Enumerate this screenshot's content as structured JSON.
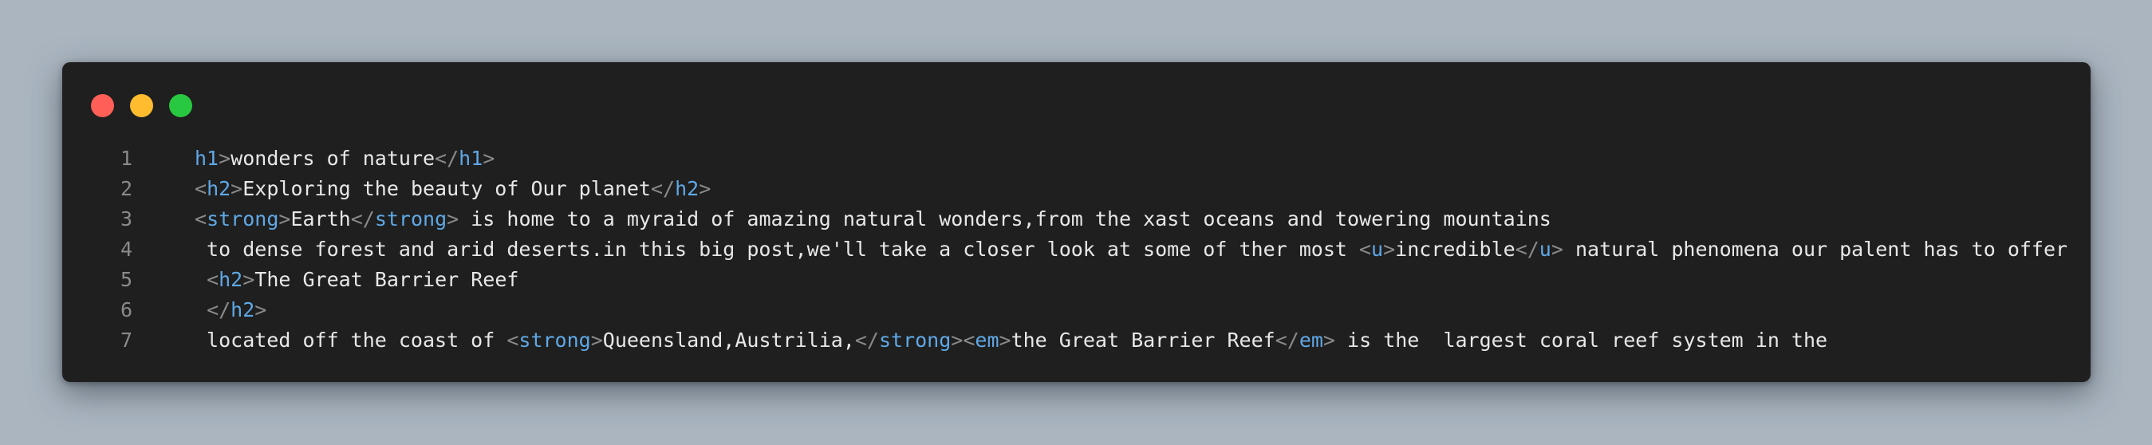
{
  "window": {
    "controls": {
      "close_color": "#ff5f57",
      "minimize_color": "#febc2e",
      "maximize_color": "#28c840"
    }
  },
  "editor": {
    "lines": [
      {
        "number": "1",
        "tokens": [
          {
            "kind": "tag",
            "text": "h1"
          },
          {
            "kind": "bracket",
            "text": ">"
          },
          {
            "kind": "text",
            "text": "wonders of nature"
          },
          {
            "kind": "bracket",
            "text": "</"
          },
          {
            "kind": "tag",
            "text": "h1"
          },
          {
            "kind": "bracket",
            "text": ">"
          }
        ]
      },
      {
        "number": "2",
        "tokens": [
          {
            "kind": "bracket",
            "text": "<"
          },
          {
            "kind": "tag",
            "text": "h2"
          },
          {
            "kind": "bracket",
            "text": ">"
          },
          {
            "kind": "text",
            "text": "Exploring the beauty of Our planet"
          },
          {
            "kind": "bracket",
            "text": "</"
          },
          {
            "kind": "tag",
            "text": "h2"
          },
          {
            "kind": "bracket",
            "text": ">"
          }
        ]
      },
      {
        "number": "3",
        "tokens": [
          {
            "kind": "bracket",
            "text": "<"
          },
          {
            "kind": "tag",
            "text": "strong"
          },
          {
            "kind": "bracket",
            "text": ">"
          },
          {
            "kind": "text",
            "text": "Earth"
          },
          {
            "kind": "bracket",
            "text": "</"
          },
          {
            "kind": "tag",
            "text": "strong"
          },
          {
            "kind": "bracket",
            "text": ">"
          },
          {
            "kind": "text",
            "text": " is home to a myraid of amazing natural wonders,from the xast oceans and towering mountains"
          }
        ]
      },
      {
        "number": "4",
        "tokens": [
          {
            "kind": "text",
            "text": " to dense forest and arid deserts.in this big post,we'll take a closer look at some of ther most "
          },
          {
            "kind": "bracket",
            "text": "<"
          },
          {
            "kind": "tag",
            "text": "u"
          },
          {
            "kind": "bracket",
            "text": ">"
          },
          {
            "kind": "text",
            "text": "incredible"
          },
          {
            "kind": "bracket",
            "text": "</"
          },
          {
            "kind": "tag",
            "text": "u"
          },
          {
            "kind": "bracket",
            "text": ">"
          },
          {
            "kind": "text",
            "text": " natural phenomena our palent has to offer"
          }
        ]
      },
      {
        "number": "5",
        "tokens": [
          {
            "kind": "text",
            "text": " "
          },
          {
            "kind": "bracket",
            "text": "<"
          },
          {
            "kind": "tag",
            "text": "h2"
          },
          {
            "kind": "bracket",
            "text": ">"
          },
          {
            "kind": "text",
            "text": "The Great Barrier Reef"
          }
        ]
      },
      {
        "number": "6",
        "tokens": [
          {
            "kind": "text",
            "text": " "
          },
          {
            "kind": "bracket",
            "text": "</"
          },
          {
            "kind": "tag",
            "text": "h2"
          },
          {
            "kind": "bracket",
            "text": ">"
          }
        ]
      },
      {
        "number": "7",
        "tokens": [
          {
            "kind": "text",
            "text": " located off the coast of "
          },
          {
            "kind": "bracket",
            "text": "<"
          },
          {
            "kind": "tag",
            "text": "strong"
          },
          {
            "kind": "bracket",
            "text": ">"
          },
          {
            "kind": "text",
            "text": "Queensland,Austrilia,"
          },
          {
            "kind": "bracket",
            "text": "</"
          },
          {
            "kind": "tag",
            "text": "strong"
          },
          {
            "kind": "bracket",
            "text": "><"
          },
          {
            "kind": "tag",
            "text": "em"
          },
          {
            "kind": "bracket",
            "text": ">"
          },
          {
            "kind": "text",
            "text": "the Great Barrier Reef"
          },
          {
            "kind": "bracket",
            "text": "</"
          },
          {
            "kind": "tag",
            "text": "em"
          },
          {
            "kind": "bracket",
            "text": ">"
          },
          {
            "kind": "text",
            "text": " is the  largest coral reef system in the"
          }
        ]
      }
    ]
  }
}
